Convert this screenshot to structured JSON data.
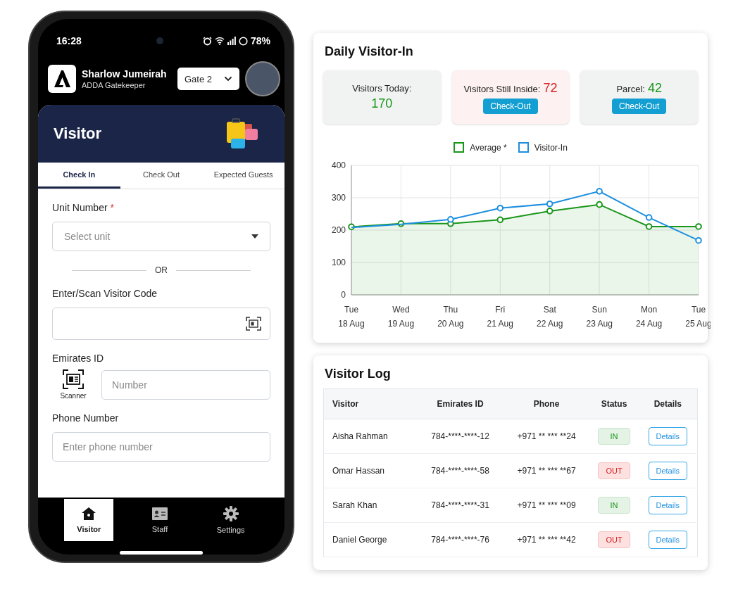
{
  "status_bar": {
    "time": "16:28",
    "battery": "78%"
  },
  "header": {
    "name": "Sharlow Jumeirah",
    "role": "ADDA Gatekeeper",
    "gate": "Gate 2"
  },
  "visitor_card": {
    "title": "Visitor"
  },
  "tabs": [
    {
      "label": "Check In",
      "selected": true
    },
    {
      "label": "Check Out",
      "selected": false
    },
    {
      "label": "Expected Guests",
      "selected": false
    }
  ],
  "form": {
    "unit_label": "Unit Number",
    "required_mark": "*",
    "unit_placeholder": "Select unit",
    "divider": "OR",
    "code_label": "Enter/Scan Visitor Code",
    "eid_label": "Emirates ID",
    "scanner_label": "Scanner",
    "eid_placeholder": "Number",
    "phone_label": "Phone Number",
    "phone_placeholder": "Enter phone number"
  },
  "bottom_nav": [
    {
      "label": "Visitor",
      "selected": true,
      "kind": "home"
    },
    {
      "label": "Staff",
      "selected": false,
      "kind": "badge"
    },
    {
      "label": "Settings",
      "selected": false,
      "kind": "gear"
    }
  ],
  "daily": {
    "title": "Daily Visitor-In",
    "stats": [
      {
        "label": "Visitors Today:",
        "value": "170",
        "kind": "plain"
      },
      {
        "label": "Visitors Still Inside:",
        "value": "72",
        "kind": "alert",
        "button": "Check-Out"
      },
      {
        "label": "Parcel:",
        "value": "42",
        "kind": "action",
        "button": "Check-Out"
      }
    ],
    "chart_data": {
      "type": "line",
      "categories": [
        "Tue 18 Aug",
        "Wed 19 Aug",
        "Thu 20 Aug",
        "Fri 21 Aug",
        "Sat 22 Aug",
        "Sun 23 Aug",
        "Mon 24 Aug",
        "Tue 25 Aug"
      ],
      "series": [
        {
          "name": "Average *",
          "color": "#1a961a",
          "type": "area",
          "marker": "circle",
          "values": [
            210,
            220,
            220,
            232,
            259,
            279,
            211,
            211
          ]
        },
        {
          "name": "Visitor-In",
          "color": "#1e8fe0",
          "type": "line",
          "marker": "circle",
          "values": [
            208,
            218,
            233,
            268,
            281,
            320,
            239,
            168
          ]
        }
      ],
      "grid": true,
      "ylim": [
        0,
        400
      ],
      "yticks": [
        0,
        100,
        200,
        300,
        400
      ]
    }
  },
  "log": {
    "title": "Visitor Log",
    "columns": [
      "Visitor",
      "Emirates ID",
      "Phone",
      "Status",
      "Details"
    ],
    "rows": [
      {
        "visitor": "Aisha Rahman",
        "emirates_id": "784-****-****-12",
        "phone": "+971 ** *** **24",
        "status": "IN",
        "checked_in": true,
        "button": "Details"
      },
      {
        "visitor": "Omar Hassan",
        "emirates_id": "784-****-****-58",
        "phone": "+971 ** *** **67",
        "status": "OUT",
        "checked_in": false,
        "button": "Details"
      },
      {
        "visitor": "Sarah Khan",
        "emirates_id": "784-****-****-31",
        "phone": "+971 ** *** **09",
        "status": "IN",
        "checked_in": true,
        "button": "Details"
      },
      {
        "visitor": "Daniel George",
        "emirates_id": "784-****-****-76",
        "phone": "+971 ** *** **42",
        "status": "OUT",
        "checked_in": false,
        "button": "Details"
      }
    ]
  }
}
